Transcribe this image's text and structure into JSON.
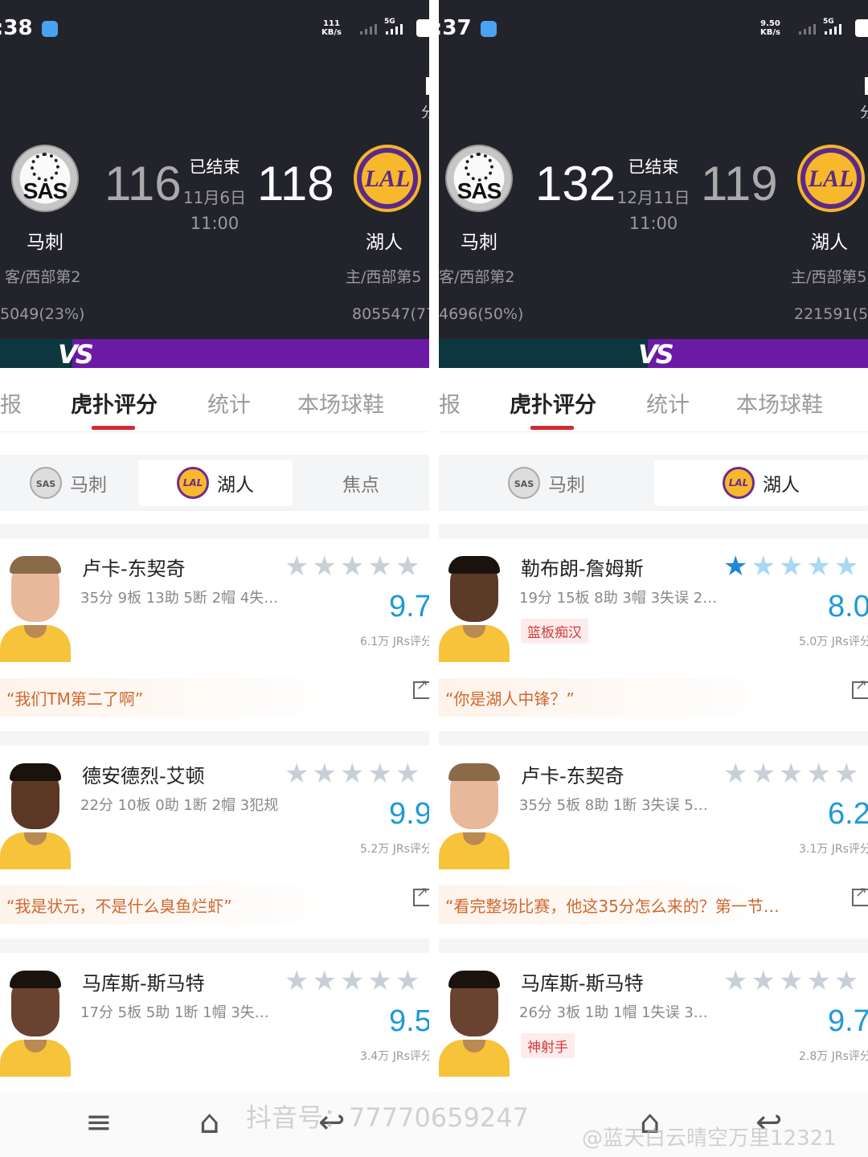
{
  "left": {
    "status_bar": {
      "time": ":38",
      "netspeed": "111\nKB/s",
      "network": "5G"
    },
    "game": {
      "status": "已结束",
      "date": "11月6日",
      "time": "11:00",
      "away": {
        "abbr": "SAS",
        "score": "116",
        "name": "马刺",
        "info": "客/西部第2",
        "votes": "5049(23%)"
      },
      "home": {
        "abbr": "LAL",
        "score": "118",
        "name": "湖人",
        "info": "主/西部第5",
        "votes": "805547(77"
      },
      "edge_char": "分"
    },
    "vs_label": "VS",
    "tabs": [
      "报",
      "虎扑评分",
      "统计",
      "本场球鞋"
    ],
    "team_switch": [
      "马刺",
      "湖人",
      "焦点"
    ],
    "players": [
      {
        "name": "卢卡-东契奇",
        "stats": "35分 9板 13助 5断 2帽 4失…",
        "tag": "",
        "score": "9.7",
        "count": "6.1万 JRs评分",
        "quote": "“我们TM第二了啊”",
        "stars_lit": 0
      },
      {
        "name": "德安德烈-艾顿",
        "stats": "22分 10板 0助 1断 2帽 3犯规",
        "tag": "",
        "score": "9.9",
        "count": "5.2万 JRs评分",
        "quote": "“我是状元，不是什么臭鱼烂虾”",
        "stars_lit": 0
      },
      {
        "name": "马库斯-斯马特",
        "stats": "17分 5板 5助 1断 1帽 3失误…",
        "tag": "",
        "score": "9.5",
        "count": "3.4万 JRs评分",
        "quote": "",
        "stars_lit": 0
      }
    ]
  },
  "right": {
    "status_bar": {
      "time": ":37",
      "netspeed": "9.50\nKB/s",
      "network": "5G"
    },
    "game": {
      "status": "已结束",
      "date": "12月11日",
      "time": "11:00",
      "away": {
        "abbr": "SAS",
        "score": "132",
        "name": "马刺",
        "info": "客/西部第2",
        "votes": "4696(50%)"
      },
      "home": {
        "abbr": "LAL",
        "score": "119",
        "name": "湖人",
        "info": "主/西部第5",
        "votes": "221591(50"
      },
      "edge_char": "分"
    },
    "vs_label": "VS",
    "tabs": [
      "报",
      "虎扑评分",
      "统计",
      "本场球鞋"
    ],
    "team_switch": [
      "马刺",
      "湖人"
    ],
    "players": [
      {
        "name": "勒布朗-詹姆斯",
        "stats": "19分 15板 8助 3帽 3失误 2…",
        "tag": "篮板痴汉",
        "score": "8.0",
        "count": "5.0万 JRs评分",
        "quote": "“你是湖人中锋？”",
        "stars_lit": 1
      },
      {
        "name": "卢卡-东契奇",
        "stats": "35分 5板 8助 1断 3失误 5…",
        "tag": "",
        "score": "6.2",
        "count": "3.1万 JRs评分",
        "quote": "“看完整场比赛，他这35分怎么来的？第一节…",
        "stars_lit": 0
      },
      {
        "name": "马库斯-斯马特",
        "stats": "26分 3板 1助 1帽 1失误 3犯规",
        "tag": "神射手",
        "score": "9.7",
        "count": "2.8万 JRs评分",
        "quote": "",
        "stars_lit": 0
      }
    ]
  },
  "watermarks": [
    "抖音号：77770659247",
    "@蓝天白云晴空万里12321"
  ],
  "nav_icons": [
    "menu-icon",
    "home-icon",
    "back-icon"
  ],
  "colors": {
    "header_bg": "#23242b",
    "vs_bar": "#6b1aa6",
    "accent_red": "#d42b32",
    "score_blue": "#1e9ad6",
    "quote_orange": "#d0682f"
  }
}
